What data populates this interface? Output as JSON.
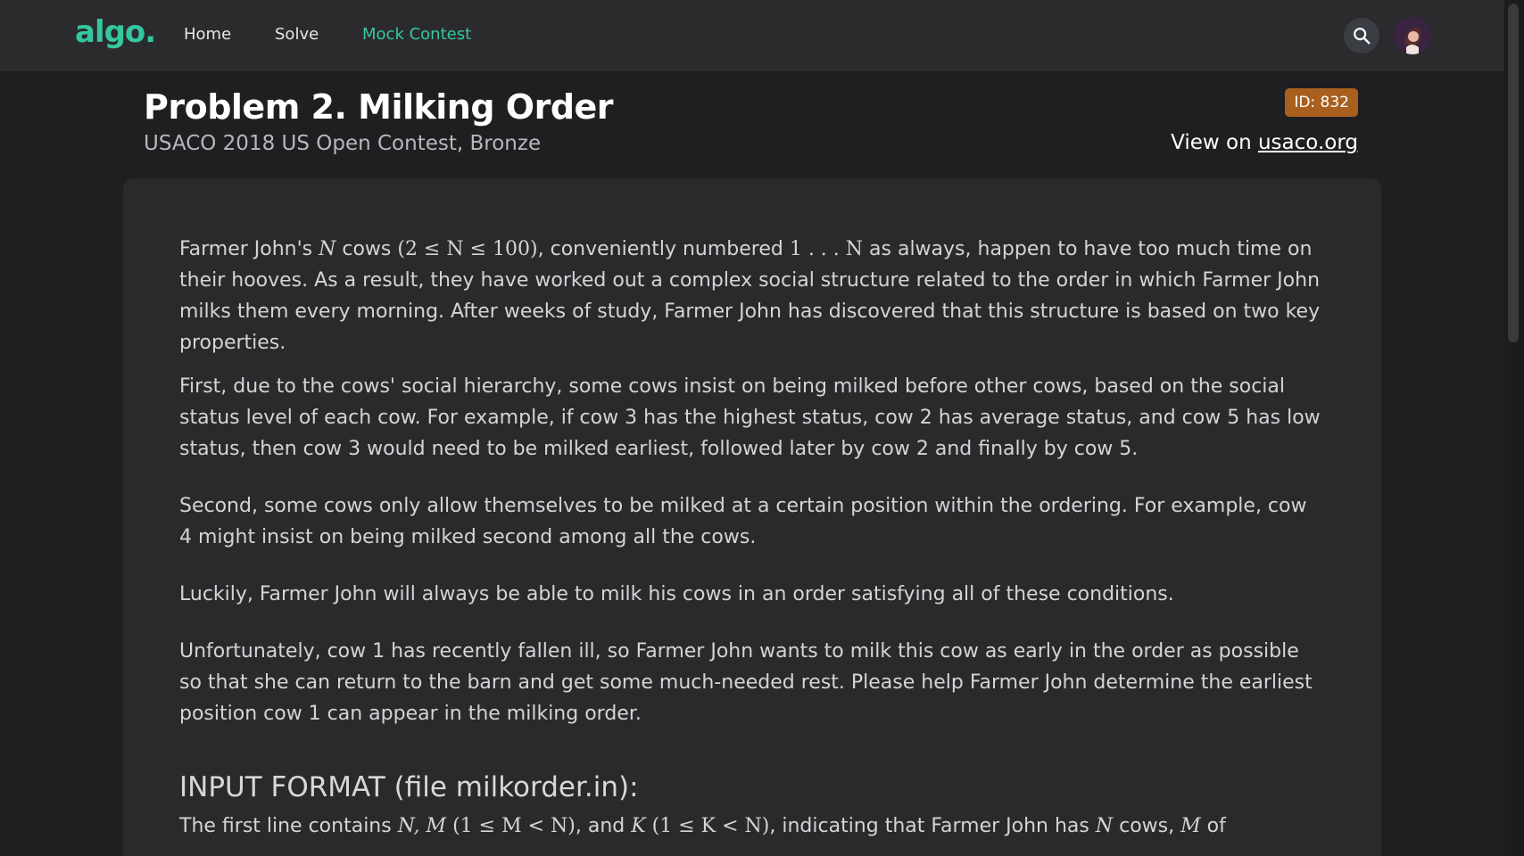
{
  "header": {
    "logo": "algo.",
    "nav": [
      "Home",
      "Solve",
      "Mock Contest"
    ],
    "active_nav": "Mock Contest",
    "search_icon": "search-icon",
    "avatar_icon": "user-avatar"
  },
  "problem": {
    "title": "Problem 2. Milking Order",
    "subtitle": "USACO 2018 US Open Contest, Bronze",
    "id_badge": "ID: 832",
    "view_on_prefix": "View on ",
    "view_on_link": "usaco.org"
  },
  "body": {
    "p1": {
      "t1": "Farmer John's ",
      "m1": "N",
      "t2": " cows ",
      "m2": "(2 ≤ N ≤ 100)",
      "t3": ", conveniently numbered ",
      "m3": "1 . . . N",
      "t4": " as always, happen to have too much time on their hooves. As a result, they have worked out a complex social structure related to the order in which Farmer John milks them every morning. After weeks of study, Farmer John has discovered that this structure is based on two key properties."
    },
    "p2": "First, due to the cows' social hierarchy, some cows insist on being milked before other cows, based on the social status level of each cow. For example, if cow 3 has the highest status, cow 2 has average status, and cow 5 has low status, then cow 3 would need to be milked earliest, followed later by cow 2 and finally by cow 5.",
    "p3": "Second, some cows only allow themselves to be milked at a certain position within the ordering. For example, cow 4 might insist on being milked second among all the cows.",
    "p4": "Luckily, Farmer John will always be able to milk his cows in an order satisfying all of these conditions.",
    "p5": "Unfortunately, cow 1 has recently fallen ill, so Farmer John wants to milk this cow as early in the order as possible so that she can return to the barn and get some much-needed rest. Please help Farmer John determine the earliest position cow 1 can appear in the milking order.",
    "input_heading": "INPUT FORMAT (file milkorder.in):",
    "p6": {
      "t1": "The first line contains ",
      "m1": "N, M",
      "m2": "(1 ≤ M < N)",
      "t2": ", and ",
      "m3": "K",
      "m4": "(1 ≤ K < N)",
      "t3": ", indicating that Farmer John has ",
      "m5": "N",
      "t4": " cows, ",
      "m6": "M",
      "t5": " of"
    }
  }
}
